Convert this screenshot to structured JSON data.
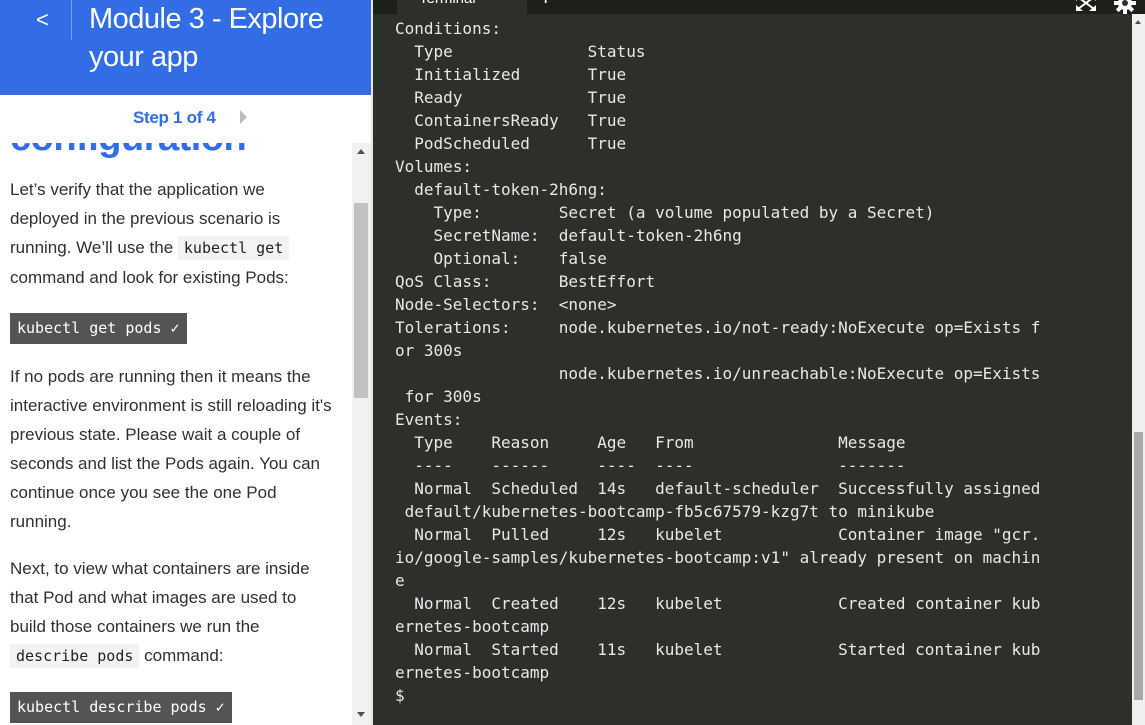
{
  "header": {
    "back_label": "<",
    "title_line1": "Module 3 - Explore",
    "title_line2": "your app",
    "accent_color": "#326de6"
  },
  "stepper": {
    "label": "Step 1 of 4",
    "next_icon": "chevron-right-icon"
  },
  "content": {
    "section_heading": "configuration",
    "para1": {
      "before": "Let’s verify that the application we deployed in the previous scenario is running. We’ll use the ",
      "code": "kubectl get",
      "after": " command and look for existing Pods:"
    },
    "cmd1": "kubectl get pods ✓",
    "para2": "If no pods are running then it means the interactive environment is still reloading it's previous state. Please wait a couple of seconds and list the Pods again. You can continue once you see the one Pod running.",
    "para3": {
      "before": "Next, to view what containers are inside that Pod and what images are used to build those containers we run the ",
      "code": "describe pods",
      "after": " command:"
    },
    "cmd2": "kubectl describe pods ✓"
  },
  "terminal": {
    "tab_label": "Terminal",
    "add_tab_label": "+",
    "expand_icon": "expand-icon",
    "settings_icon": "gear-icon",
    "output": "Conditions:\n  Type              Status\n  Initialized       True\n  Ready             True\n  ContainersReady   True\n  PodScheduled      True\nVolumes:\n  default-token-2h6ng:\n    Type:        Secret (a volume populated by a Secret)\n    SecretName:  default-token-2h6ng\n    Optional:    false\nQoS Class:       BestEffort\nNode-Selectors:  <none>\nTolerations:     node.kubernetes.io/not-ready:NoExecute op=Exists f\nor 300s\n                 node.kubernetes.io/unreachable:NoExecute op=Exists\n for 300s\nEvents:\n  Type    Reason     Age   From               Message\n  ----    ------     ----  ----               -------\n  Normal  Scheduled  14s   default-scheduler  Successfully assigned\n default/kubernetes-bootcamp-fb5c67579-kzg7t to minikube\n  Normal  Pulled     12s   kubelet            Container image \"gcr.\nio/google-samples/kubernetes-bootcamp:v1\" already present on machin\ne\n  Normal  Created    12s   kubelet            Created container kub\nernetes-bootcamp\n  Normal  Started    11s   kubelet            Started container kub\nernetes-bootcamp\n$"
  }
}
